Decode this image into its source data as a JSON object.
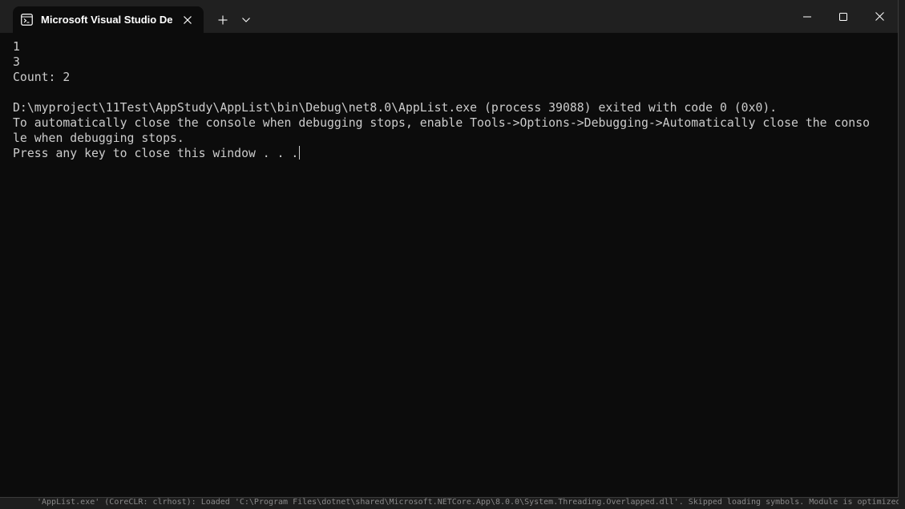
{
  "window": {
    "tab_title": "Microsoft Visual Studio Debug Console",
    "new_tab_label": "+",
    "dropdown_label": "⌄"
  },
  "console": {
    "lines": [
      "1",
      "3",
      "Count: 2",
      "",
      "D:\\myproject\\11Test\\AppStudy\\AppList\\bin\\Debug\\net8.0\\AppList.exe (process 39088) exited with code 0 (0x0).",
      "To automatically close the console when debugging stops, enable Tools->Options->Debugging->Automatically close the conso",
      "le when debugging stops.",
      "Press any key to close this window . . ."
    ]
  },
  "background": {
    "output_text": "'AppList.exe' (CoreCLR: clrhost): Loaded 'C:\\Program Files\\dotnet\\shared\\Microsoft.NETCore.App\\8.0.0\\System.Threading.Overlapped.dll'. Skipped loading symbols. Module is optimized"
  },
  "colors": {
    "console_bg": "#0c0c0c",
    "titlebar_bg": "#202020",
    "text": "#cccccc"
  }
}
